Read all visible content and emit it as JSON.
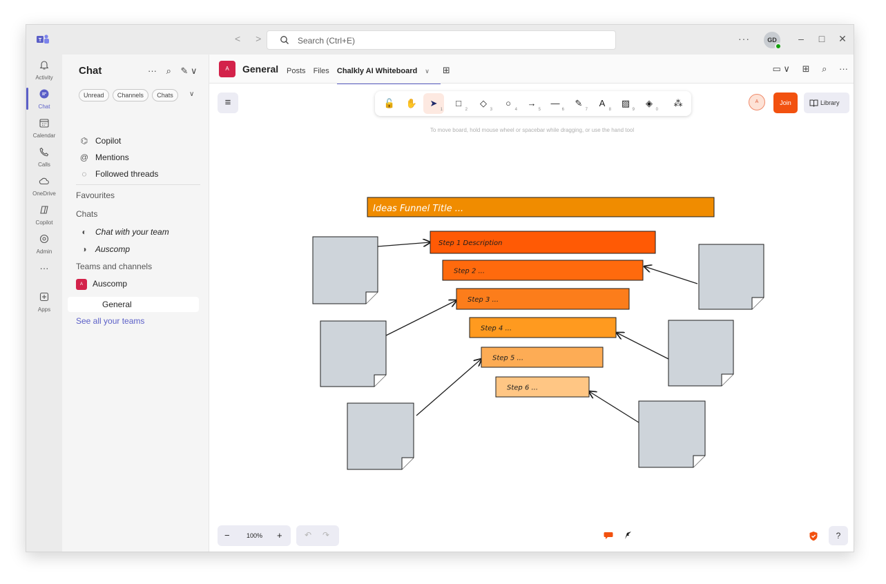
{
  "titlebar": {
    "nav_back": "<",
    "nav_forward": ">",
    "search_placeholder": "Search (Ctrl+E)",
    "more": "···",
    "user_initials": "GD",
    "minimize": "–",
    "maximize": "□",
    "close": "✕"
  },
  "rail": {
    "items": [
      {
        "label": "Activity"
      },
      {
        "label": "Chat"
      },
      {
        "label": "Calendar"
      },
      {
        "label": "Calls"
      },
      {
        "label": "OneDrive"
      },
      {
        "label": "Copilot"
      },
      {
        "label": "Admin"
      },
      {
        "label": "···"
      },
      {
        "label": "Apps"
      }
    ]
  },
  "chatpane": {
    "title": "Chat",
    "more": "···",
    "filters": [
      "Unread",
      "Channels",
      "Chats"
    ],
    "quick": [
      {
        "label": "Copilot"
      },
      {
        "label": "Mentions"
      },
      {
        "label": "Followed threads"
      }
    ],
    "favourites_label": "Favourites",
    "chats_label": "Chats",
    "chats": [
      {
        "label": "Chat with your team"
      },
      {
        "label": "Auscomp"
      }
    ],
    "teams_label": "Teams and channels",
    "team": {
      "badge": "A",
      "label": "Auscomp"
    },
    "channel": "General",
    "see_all": "See all your teams"
  },
  "channel_header": {
    "badge": "A",
    "name": "General",
    "tabs": [
      "Posts",
      "Files",
      "Chalkly AI Whiteboard"
    ],
    "tab_chevron": "∨",
    "add_tab": "⊞"
  },
  "whiteboard": {
    "hint": "To move board, hold mouse wheel or spacebar while dragging, or use the hand tool",
    "tools": [
      {
        "icon": "🔓",
        "key": ""
      },
      {
        "icon": "✋",
        "key": ""
      },
      {
        "icon": "➤",
        "key": "1"
      },
      {
        "icon": "□",
        "key": "2"
      },
      {
        "icon": "◇",
        "key": "3"
      },
      {
        "icon": "○",
        "key": "4"
      },
      {
        "icon": "→",
        "key": "5"
      },
      {
        "icon": "—",
        "key": "6"
      },
      {
        "icon": "✎",
        "key": "7"
      },
      {
        "icon": "A",
        "key": "8"
      },
      {
        "icon": "▨",
        "key": "9"
      },
      {
        "icon": "◈",
        "key": "0"
      },
      {
        "icon": "⁂",
        "key": ""
      }
    ],
    "collaborator_initial": "A",
    "join_label": "Join",
    "library_label": "Library",
    "funnel_title": "Ideas Funnel Title ...",
    "steps": [
      {
        "label": "Step 1 Description",
        "color": "#ff5a05"
      },
      {
        "label": "Step 2 ...",
        "color": "#ff6a0d"
      },
      {
        "label": "Step 3 ...",
        "color": "#fc7d1b"
      },
      {
        "label": "Step 4 ...",
        "color": "#ff9a1f"
      },
      {
        "label": "Step 5 ...",
        "color": "#fdac55"
      },
      {
        "label": "Step 6 ...",
        "color": "#ffc684"
      }
    ],
    "title_color": "#f08c00",
    "note_color": "#ced4da",
    "zoom_minus": "−",
    "zoom_value": "100%",
    "zoom_plus": "+",
    "undo": "↶",
    "redo": "↷",
    "help": "?"
  },
  "colors": {
    "accent": "#5b5fc7",
    "join": "#f2510f",
    "team_badge": "#d3224a"
  }
}
